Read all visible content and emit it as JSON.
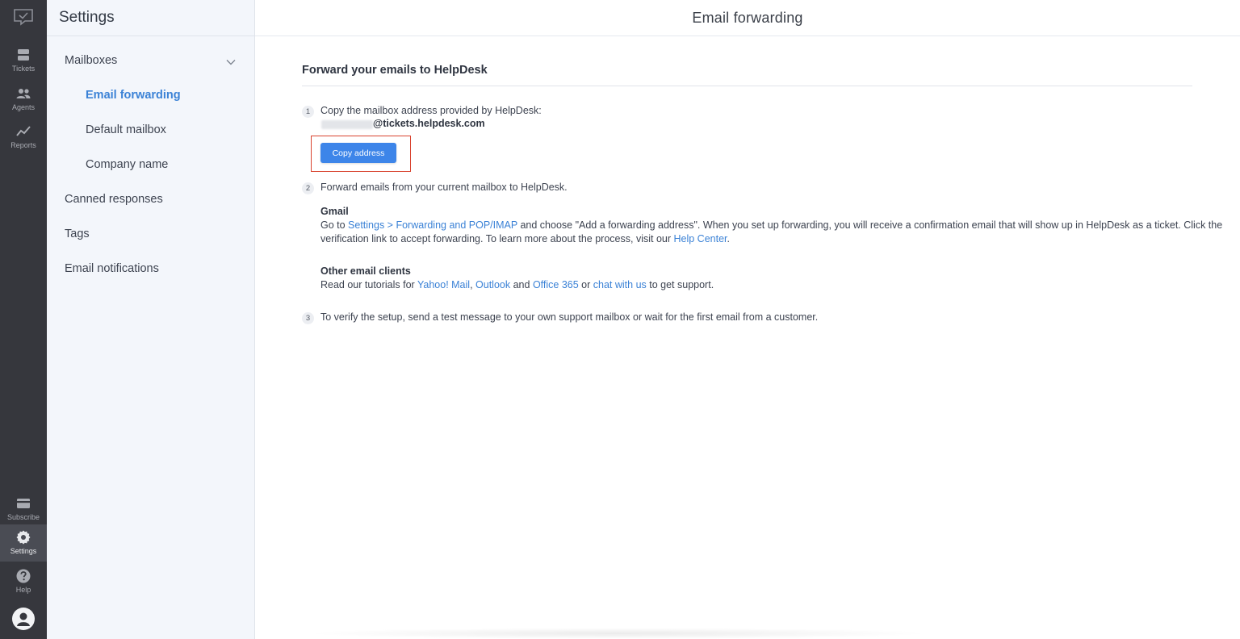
{
  "rail": {
    "items": [
      {
        "label": "Tickets",
        "icon": "tickets-icon"
      },
      {
        "label": "Agents",
        "icon": "agents-icon"
      },
      {
        "label": "Reports",
        "icon": "reports-icon"
      },
      {
        "label": "Subscribe",
        "icon": "subscribe-icon"
      },
      {
        "label": "Settings",
        "icon": "settings-icon"
      },
      {
        "label": "Help",
        "icon": "help-icon"
      }
    ]
  },
  "sidebar": {
    "title": "Settings",
    "items": [
      {
        "label": "Mailboxes"
      },
      {
        "label": "Email forwarding"
      },
      {
        "label": "Default mailbox"
      },
      {
        "label": "Company name"
      },
      {
        "label": "Canned responses"
      },
      {
        "label": "Tags"
      },
      {
        "label": "Email notifications"
      }
    ]
  },
  "main": {
    "title": "Email forwarding",
    "section_title": "Forward your emails to HelpDesk",
    "step1": {
      "num": "1",
      "text": "Copy the mailbox address provided by HelpDesk:",
      "address_domain": "@tickets.helpdesk.com",
      "button": "Copy address"
    },
    "step2": {
      "num": "2",
      "text": "Forward emails from your current mailbox to HelpDesk.",
      "gmail_title": "Gmail",
      "gmail_pre": "Go to ",
      "gmail_link": "Settings > Forwarding and POP/IMAP",
      "gmail_mid": " and choose \"Add a forwarding address\". When you set up forwarding, you will receive a confirmation email that will show up in HelpDesk as a ticket. Click the",
      "gmail_line2": "verification link to accept forwarding. To learn more about the process, visit our ",
      "gmail_help_link": "Help Center",
      "gmail_end": ".",
      "other_title": "Other email clients",
      "other_pre": "Read our tutorials for ",
      "other_link1": "Yahoo! Mail",
      "other_sep1": ", ",
      "other_link2": "Outlook",
      "other_sep2": " and ",
      "other_link3": "Office 365",
      "other_sep3": " or ",
      "other_link4": "chat with us",
      "other_end": " to get support."
    },
    "step3": {
      "num": "3",
      "text": "To verify the setup, send a test message to your own support mailbox or wait for the first email from a customer."
    }
  },
  "colors": {
    "rail_bg": "#36373d",
    "sidebar_bg": "#f3f6fb",
    "accent": "#3b82d6",
    "button": "#3d85e9",
    "highlight": "#d9432f"
  }
}
